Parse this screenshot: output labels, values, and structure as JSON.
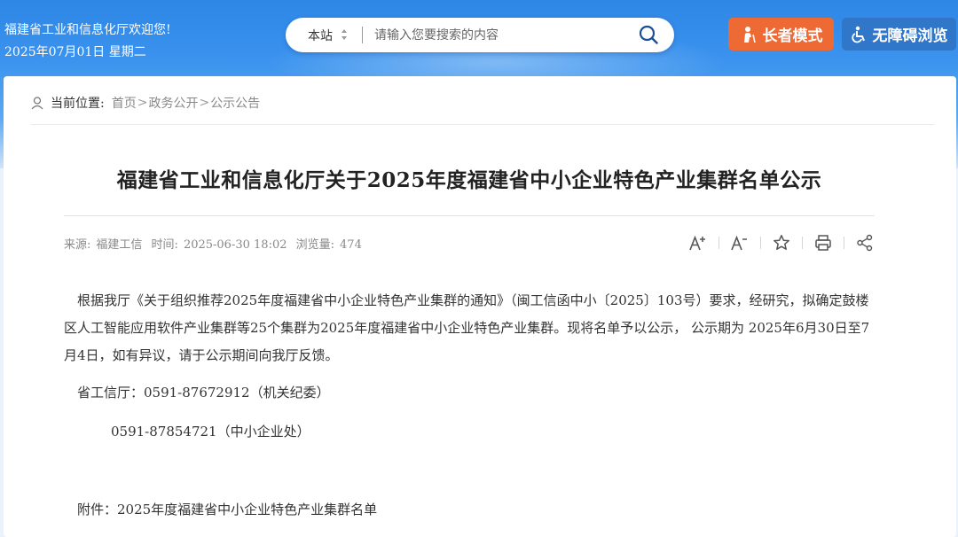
{
  "header": {
    "welcome": "福建省工业和信息化厅欢迎您!",
    "date": "2025年07月01日 星期二",
    "search": {
      "scope": "本站",
      "placeholder": "请输入您要搜索的内容",
      "icon": "search-icon"
    },
    "elder_mode_label": "长者模式",
    "accessible_label": "无障碍浏览",
    "colors": {
      "elder": "#ee6a34",
      "accessible": "#3177c9"
    }
  },
  "breadcrumb": {
    "label": "当前位置:",
    "items": [
      "首页",
      "政务公开",
      "公示公告"
    ],
    "separator": ">"
  },
  "article": {
    "title": "福建省工业和信息化厅关于2025年度福建省中小企业特色产业集群名单公示",
    "meta": {
      "source_label": "来源:",
      "source": "福建工信",
      "time_label": "时间:",
      "time": "2025-06-30 18:02",
      "views_label": "浏览量:",
      "views": "474"
    },
    "tools": [
      "font-increase-icon",
      "font-decrease-icon",
      "star-icon",
      "print-icon",
      "share-icon"
    ],
    "paragraph": "根据我厅《关于组织推荐2025年度福建省中小企业特色产业集群的通知》（闽工信函中小〔2025〕103号）要求，经研究，拟确定鼓楼区人工智能应用软件产业集群等25个集群为2025年度福建省中小企业特色产业集群。现将名单予以公示， 公示期为 2025年6月30日至7月4日，如有异议，请于公示期间向我厅反馈。",
    "contact1": "省工信厅：0591-87672912（机关纪委）",
    "contact2": "0591-87854721（中小企业处）",
    "attachment": "附件：2025年度福建省中小企业特色产业集群名单"
  }
}
